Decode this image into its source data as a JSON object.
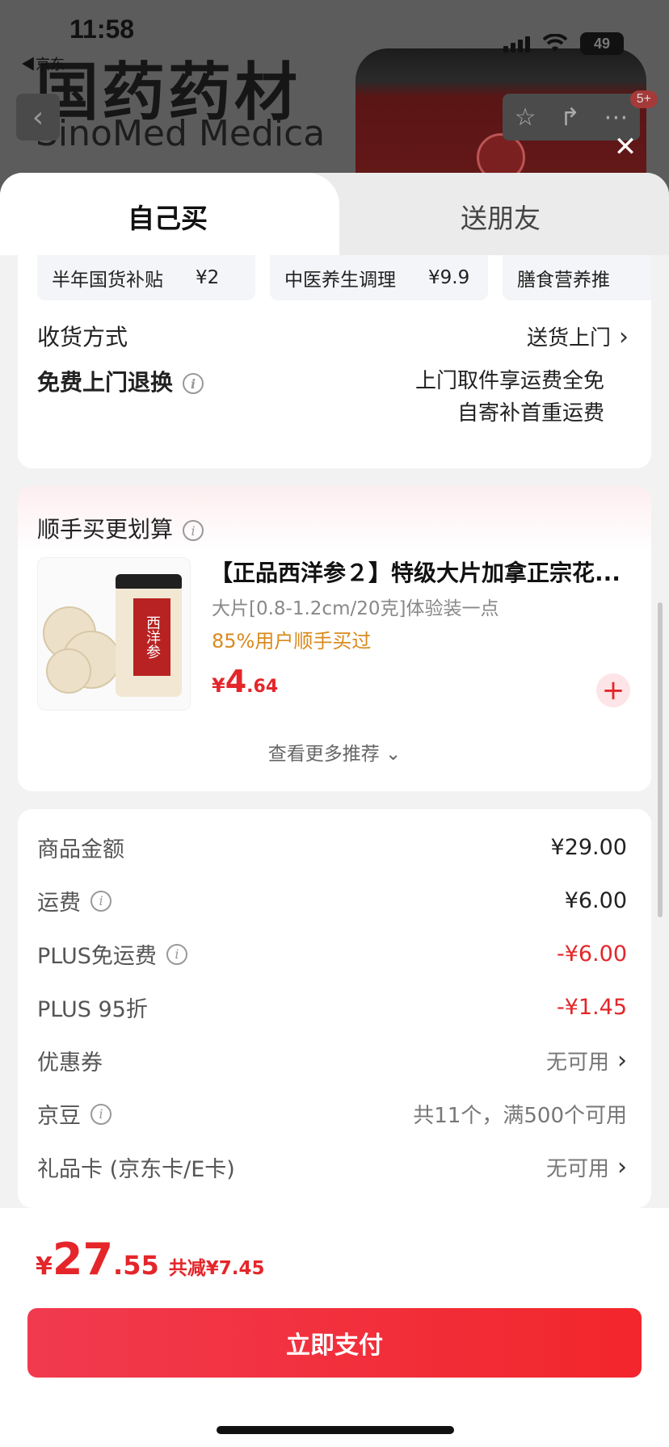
{
  "status_bar": {
    "time": "11:58",
    "back_label": "◀京东",
    "battery": "49"
  },
  "background": {
    "brand_cn": "国药药材",
    "brand_en": "SinoMed Medica",
    "cart_badge": "5+"
  },
  "tabs": [
    {
      "label": "自己买",
      "active": true
    },
    {
      "label": "送朋友",
      "active": false
    }
  ],
  "subsidies": [
    {
      "label": "半年国货补贴",
      "amount": "¥2"
    },
    {
      "label": "中医养生调理",
      "amount": "¥9.9"
    },
    {
      "label": "膳食营养推",
      "amount": ""
    }
  ],
  "delivery": {
    "label": "收货方式",
    "value": "送货上门"
  },
  "free_return": {
    "label": "免费上门退换",
    "line1": "上门取件享运费全免",
    "line2": "自寄补首重运费"
  },
  "addon": {
    "title": "顺手买更划算",
    "product_title": "【正品西洋参２】特级大片加拿正宗花...",
    "product_spec": "大片[0.8-1.2cm/20克]体验装一点",
    "product_hint": "85%用户顺手买过",
    "price_currency": "¥",
    "price_int": "4",
    "price_dec": ".64",
    "jar_label": "西洋参",
    "more": "查看更多推荐"
  },
  "fees": [
    {
      "label": "商品金额",
      "value": "¥29.00",
      "info": false,
      "style": "normal",
      "chevron": false
    },
    {
      "label": "运费",
      "value": "¥6.00",
      "info": true,
      "style": "normal",
      "chevron": false
    },
    {
      "label": "PLUS免运费",
      "value": "-¥6.00",
      "info": true,
      "style": "red",
      "chevron": false
    },
    {
      "label": "PLUS 95折",
      "value": "-¥1.45",
      "info": false,
      "style": "red",
      "chevron": false
    },
    {
      "label": "优惠券",
      "value": "无可用",
      "info": false,
      "style": "grey",
      "chevron": true
    },
    {
      "label": "京豆",
      "value": "共11个，满500个可用",
      "info": true,
      "style": "grey",
      "chevron": false
    },
    {
      "label": "礼品卡 (京东卡/E卡)",
      "value": "无可用",
      "info": false,
      "style": "grey",
      "chevron": true
    }
  ],
  "total": {
    "currency": "¥",
    "int": "27",
    "dec": ".55",
    "saved": "共减¥7.45"
  },
  "pay_button": "立即支付",
  "colors": {
    "accent_red": "#e4262a",
    "hint_orange": "#d98a1c"
  }
}
